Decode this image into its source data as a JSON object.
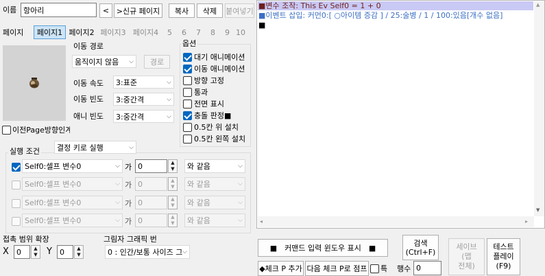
{
  "top": {
    "name_label": "이름",
    "name_value": "항아리",
    "prev_button": "<",
    "new_page_button": ">신규 페이지",
    "copy_button": "복사",
    "delete_button": "삭제",
    "paste_button": "붙여넣기"
  },
  "tabs": {
    "label": "페이지",
    "items": [
      "페이지1",
      "페이지2",
      "페이지3",
      "페이지4",
      "5",
      "6",
      "7",
      "8",
      "9",
      "10"
    ]
  },
  "move": {
    "route_label": "이동 경로",
    "route_value": "움직이지 않음",
    "route_button": "경로",
    "speed_label": "이동 속도",
    "speed_value": "3:표준",
    "freq_label": "이동 빈도",
    "freq_value": "3:중간격",
    "anim_label": "애니 빈도",
    "anim_value": "3:중간격"
  },
  "options": {
    "title": "옵션",
    "items": [
      {
        "label": "대기 애니메이션",
        "checked": true
      },
      {
        "label": "이동 애니메이션",
        "checked": true
      },
      {
        "label": "방향 고정",
        "checked": false
      },
      {
        "label": "통과",
        "checked": false
      },
      {
        "label": "전면 표시",
        "checked": false
      },
      {
        "label": "충돌 판정■",
        "checked": true
      },
      {
        "label": "0.5칸 위 설치",
        "checked": false
      },
      {
        "label": "0.5칸 왼쪽 설치",
        "checked": false
      }
    ]
  },
  "prev_page_dir": "이전Page방향인계",
  "exec": {
    "label": "실행 조건",
    "trigger_value": "결정 키로 실행",
    "conditions": [
      {
        "checked": true,
        "var": "Self0:셀프 변수0",
        "ga": "가",
        "value": "0",
        "op": "와 같음",
        "enabled": true
      },
      {
        "checked": false,
        "var": "Self0:셀프 변수0",
        "ga": "가",
        "value": "0",
        "op": "와 같음",
        "enabled": false
      },
      {
        "checked": false,
        "var": "Self0:셀프 변수0",
        "ga": "가",
        "value": "0",
        "op": "와 같음",
        "enabled": false
      },
      {
        "checked": false,
        "var": "Self0:셀프 변수0",
        "ga": "가",
        "value": "0",
        "op": "와 같음",
        "enabled": false
      }
    ]
  },
  "contact": {
    "label": "접촉 범위 확장",
    "x_label": "X",
    "x_value": "0",
    "y_label": "Y",
    "y_value": "0"
  },
  "shadow": {
    "label": "그림자 그래픽 번",
    "value": "0 : 인간/보통 사이즈 그"
  },
  "commands": [
    {
      "text": "■변수 조작: This Ev Self0 = 1 + 0",
      "color": "#6b1e1e",
      "selected": true
    },
    {
      "text": "■이벤트 삽입: 커먼0:[ ○아이템 증감 ] / 25:술병 / 1 / 100:있음[개수 없음]",
      "color": "#3b6fc4",
      "selected": false
    },
    {
      "text": "■",
      "color": "#000000",
      "selected": false
    }
  ],
  "bottom": {
    "cmd_window_button": "■　커맨드 입력 윈도우 표시　■",
    "search_button_line1": "검색",
    "search_button_line2": "(Ctrl+F)",
    "save_button_line1": "세이브",
    "save_button_line2": "(맵",
    "save_button_line3": "전체)",
    "test_button_line1": "테스트",
    "test_button_line2": "플레이",
    "test_button_line3": "(F9)",
    "add_check_button": "◆체크 P 추가",
    "next_check_button": "다음 체크 P로 점프",
    "special_label": "특",
    "line_count_label": "행수",
    "line_count_value": "0"
  },
  "colors": {
    "selection": "#c9c9f5",
    "accent": "#0067c0"
  }
}
